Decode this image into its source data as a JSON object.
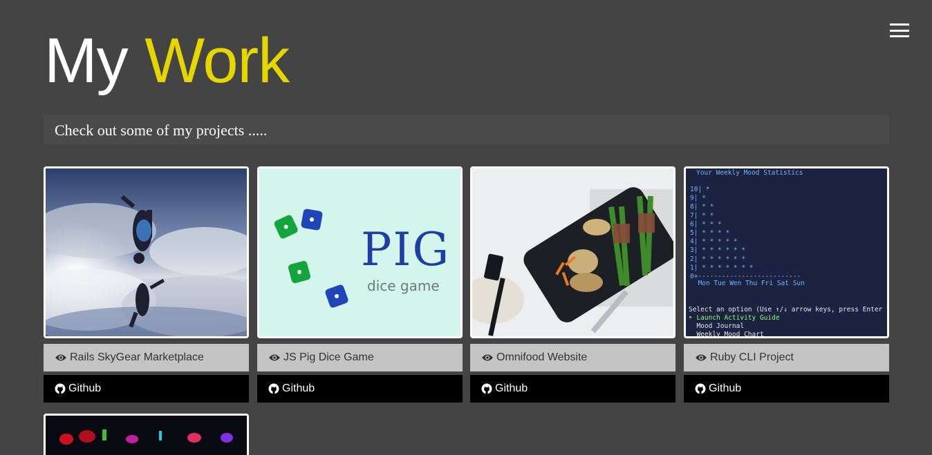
{
  "header": {
    "title_white": "My",
    "title_accent": "Work",
    "subtitle": "Check out some of my projects ....."
  },
  "colors": {
    "background": "#444444",
    "accent": "#e6d600",
    "view_button": "#c4c4c4",
    "github_button": "#000000"
  },
  "projects": [
    {
      "view_label": "Rails SkyGear Marketplace",
      "github_label": "Github",
      "view_icon": "eye-icon",
      "github_icon": "github-icon"
    },
    {
      "view_label": "JS Pig Dice Game",
      "github_label": "Github",
      "view_icon": "eye-icon",
      "github_icon": "github-icon"
    },
    {
      "view_label": "Omnifood Website",
      "github_label": "Github",
      "view_icon": "eye-icon",
      "github_icon": "github-icon"
    },
    {
      "view_label": "Ruby CLI Project",
      "github_label": "Github",
      "view_icon": "eye-icon",
      "github_icon": "github-icon"
    }
  ],
  "thumbnails": {
    "pig": {
      "title": "PIG",
      "caption": "dice game"
    },
    "terminal": {
      "heading": "Your Weekly Mood Statistics",
      "rows": [
        "10|                  *",
        " 9|                  *",
        " 8|                  *  *",
        " 7|                  *  *",
        " 6|        *         *  *",
        " 5|        *  *      *  *",
        " 4|        *  *  *   *  *",
        " 3|     *  *  *  *   *  *",
        " 2|     *  *  *  *   *  *",
        " 1|  *  *  *  *  *   *  *",
        " 0+--------------------------"
      ],
      "days": "  Mon Tue Wen Thu Fri Sat Sun",
      "prompt": "Select an option (Use ↑/↓ arrow keys, press Enter to se",
      "options": [
        "‣ Launch Activity Guide",
        "  Mood Journal",
        "  Weekly Mood Chart"
      ]
    }
  }
}
